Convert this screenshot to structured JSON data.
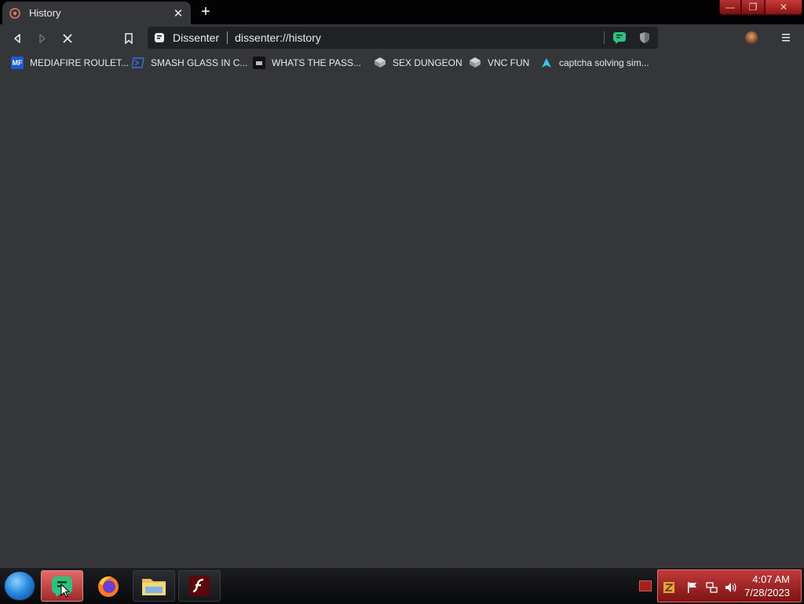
{
  "tab": {
    "title": "History",
    "close_glyph": "✕",
    "new_tab_glyph": "+"
  },
  "window_controls": {
    "minimize": "—",
    "maximize": "❐",
    "close": "✕"
  },
  "toolbar": {
    "site_chip": "Dissenter",
    "url": "dissenter://history"
  },
  "bookmarks": [
    {
      "label": "MEDIAFIRE ROULET...",
      "icon": "mediafire-icon"
    },
    {
      "label": "SMASH GLASS IN C...",
      "icon": "powershell-icon"
    },
    {
      "label": "WHATS THE PASS...",
      "icon": "terminal-icon"
    },
    {
      "label": "SEX DUNGEON",
      "icon": "server-icon"
    },
    {
      "label": "VNC FUN",
      "icon": "server-icon"
    },
    {
      "label": "captcha solving sim...",
      "icon": "arch-icon"
    }
  ],
  "taskbar": {
    "items": [
      "dissenter-browser",
      "firefox",
      "file-explorer",
      "flash-player"
    ]
  },
  "clock": {
    "time": "4:07 AM",
    "date": "7/28/2023"
  },
  "colors": {
    "background": "#35363a",
    "omnibox": "#202124",
    "taskbar_accent": "#c13a3a",
    "chip_green": "#2ec27e"
  }
}
